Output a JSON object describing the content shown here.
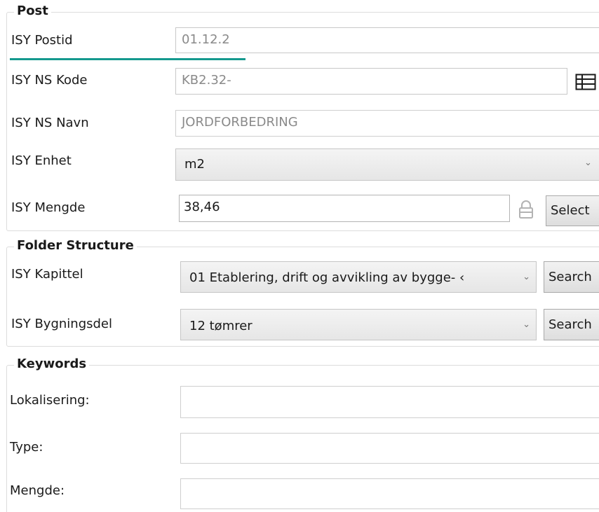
{
  "post": {
    "title": "Post",
    "postid": {
      "label": "ISY Postid",
      "value": "01.12.2"
    },
    "ns_kode": {
      "label": "ISY NS Kode",
      "value": "KB2.32-"
    },
    "ns_navn": {
      "label": "ISY NS Navn",
      "value": "JORDFORBEDRING"
    },
    "enhet": {
      "label": "ISY Enhet",
      "value": "m2"
    },
    "mengde": {
      "label": "ISY Mengde",
      "value": "38,46",
      "button": "Select"
    }
  },
  "folder": {
    "title": "Folder Structure",
    "kapittel": {
      "label": "ISY Kapittel",
      "value": "01 Etablering, drift og avvikling av bygge- ‹",
      "button": "Search"
    },
    "bygningsdel": {
      "label": "ISY Bygningsdel",
      "value": "12 tømrer",
      "button": "Search"
    }
  },
  "keywords": {
    "title": "Keywords",
    "lokalisering": {
      "label": "Lokalisering:",
      "value": ""
    },
    "type": {
      "label": "Type:",
      "value": ""
    },
    "mengde": {
      "label": "Mengde:",
      "value": ""
    }
  },
  "icons": {
    "ns_kode_picker": "table-icon",
    "mengde_lock": "lock-icon",
    "dropdown": "chevron-down-icon"
  },
  "colors": {
    "focus_underline": "#15998e"
  }
}
